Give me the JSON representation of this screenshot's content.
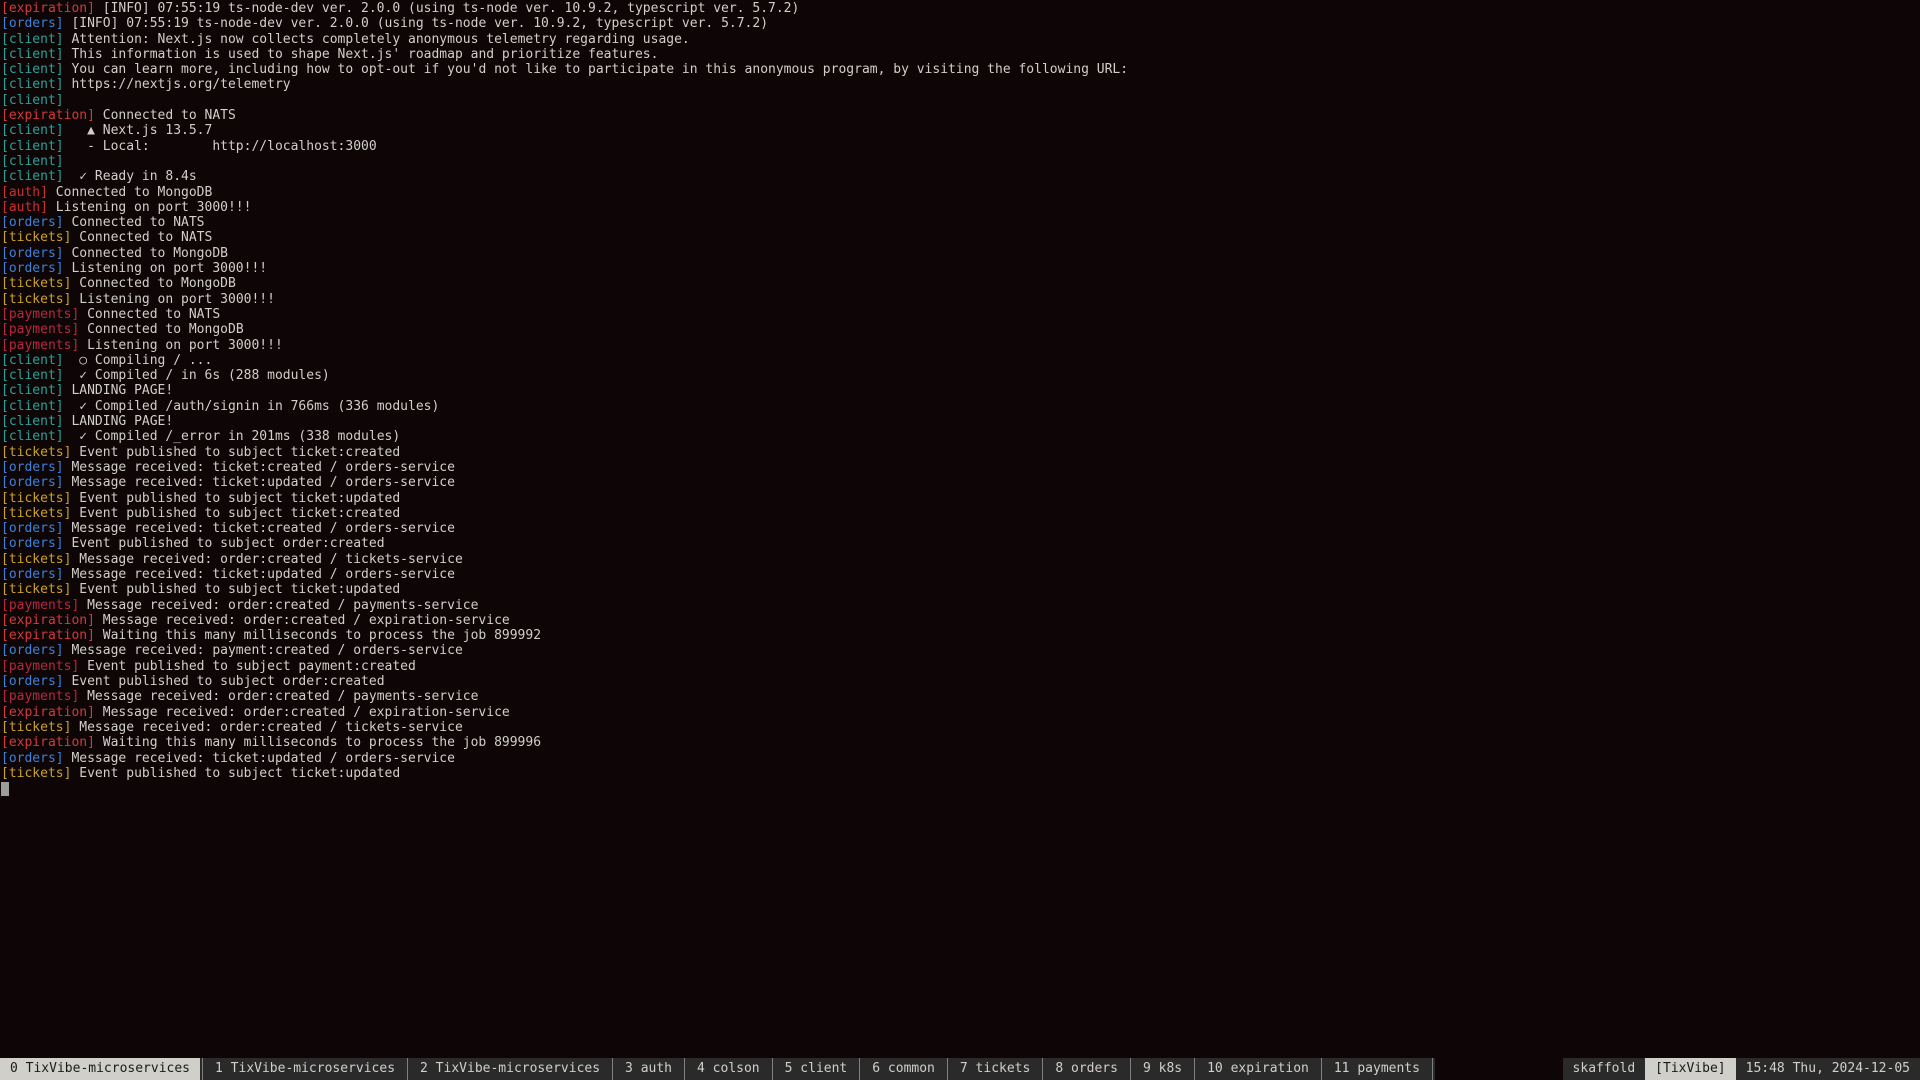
{
  "services": {
    "expiration": {
      "label": "[expiration]",
      "css": "c-expiration"
    },
    "orders": {
      "label": "[orders]",
      "css": "c-orders"
    },
    "client": {
      "label": "[client]",
      "css": "c-client"
    },
    "auth": {
      "label": "[auth]",
      "css": "c-auth"
    },
    "tickets": {
      "label": "[tickets]",
      "css": "c-tickets"
    },
    "payments": {
      "label": "[payments]",
      "css": "c-payments"
    }
  },
  "log_lines": [
    {
      "svc": "expiration",
      "msg": "[INFO] 07:55:19 ts-node-dev ver. 2.0.0 (using ts-node ver. 10.9.2, typescript ver. 5.7.2)"
    },
    {
      "svc": "orders",
      "msg": "[INFO] 07:55:19 ts-node-dev ver. 2.0.0 (using ts-node ver. 10.9.2, typescript ver. 5.7.2)"
    },
    {
      "svc": "client",
      "msg": "Attention: Next.js now collects completely anonymous telemetry regarding usage."
    },
    {
      "svc": "client",
      "msg": "This information is used to shape Next.js' roadmap and prioritize features."
    },
    {
      "svc": "client",
      "msg": "You can learn more, including how to opt-out if you'd not like to participate in this anonymous program, by visiting the following URL:"
    },
    {
      "svc": "client",
      "msg": "https://nextjs.org/telemetry"
    },
    {
      "svc": "client",
      "msg": ""
    },
    {
      "svc": "expiration",
      "msg": "Connected to NATS"
    },
    {
      "svc": "client",
      "msg": "  ▲ Next.js 13.5.7"
    },
    {
      "svc": "client",
      "msg": "  - Local:        http://localhost:3000"
    },
    {
      "svc": "client",
      "msg": ""
    },
    {
      "svc": "client",
      "msg": " ✓ Ready in 8.4s"
    },
    {
      "svc": "auth",
      "msg": "Connected to MongoDB"
    },
    {
      "svc": "auth",
      "msg": "Listening on port 3000!!!"
    },
    {
      "svc": "orders",
      "msg": "Connected to NATS"
    },
    {
      "svc": "tickets",
      "msg": "Connected to NATS"
    },
    {
      "svc": "orders",
      "msg": "Connected to MongoDB"
    },
    {
      "svc": "orders",
      "msg": "Listening on port 3000!!!"
    },
    {
      "svc": "tickets",
      "msg": "Connected to MongoDB"
    },
    {
      "svc": "tickets",
      "msg": "Listening on port 3000!!!"
    },
    {
      "svc": "payments",
      "msg": "Connected to NATS"
    },
    {
      "svc": "payments",
      "msg": "Connected to MongoDB"
    },
    {
      "svc": "payments",
      "msg": "Listening on port 3000!!!"
    },
    {
      "svc": "client",
      "msg": " ○ Compiling / ..."
    },
    {
      "svc": "client",
      "msg": " ✓ Compiled / in 6s (288 modules)"
    },
    {
      "svc": "client",
      "msg": "LANDING PAGE!"
    },
    {
      "svc": "client",
      "msg": " ✓ Compiled /auth/signin in 766ms (336 modules)"
    },
    {
      "svc": "client",
      "msg": "LANDING PAGE!"
    },
    {
      "svc": "client",
      "msg": " ✓ Compiled /_error in 201ms (338 modules)"
    },
    {
      "svc": "tickets",
      "msg": "Event published to subject ticket:created"
    },
    {
      "svc": "orders",
      "msg": "Message received: ticket:created / orders-service"
    },
    {
      "svc": "orders",
      "msg": "Message received: ticket:updated / orders-service"
    },
    {
      "svc": "tickets",
      "msg": "Event published to subject ticket:updated"
    },
    {
      "svc": "tickets",
      "msg": "Event published to subject ticket:created"
    },
    {
      "svc": "orders",
      "msg": "Message received: ticket:created / orders-service"
    },
    {
      "svc": "orders",
      "msg": "Event published to subject order:created"
    },
    {
      "svc": "tickets",
      "msg": "Message received: order:created / tickets-service"
    },
    {
      "svc": "orders",
      "msg": "Message received: ticket:updated / orders-service"
    },
    {
      "svc": "tickets",
      "msg": "Event published to subject ticket:updated"
    },
    {
      "svc": "payments",
      "msg": "Message received: order:created / payments-service"
    },
    {
      "svc": "expiration",
      "msg": "Message received: order:created / expiration-service"
    },
    {
      "svc": "expiration",
      "msg": "Waiting this many milliseconds to process the job 899992"
    },
    {
      "svc": "orders",
      "msg": "Message received: payment:created / orders-service"
    },
    {
      "svc": "payments",
      "msg": "Event published to subject payment:created"
    },
    {
      "svc": "orders",
      "msg": "Event published to subject order:created"
    },
    {
      "svc": "payments",
      "msg": "Message received: order:created / payments-service"
    },
    {
      "svc": "expiration",
      "msg": "Message received: order:created / expiration-service"
    },
    {
      "svc": "tickets",
      "msg": "Message received: order:created / tickets-service"
    },
    {
      "svc": "expiration",
      "msg": "Waiting this many milliseconds to process the job 899996"
    },
    {
      "svc": "orders",
      "msg": "Message received: ticket:updated / orders-service"
    },
    {
      "svc": "tickets",
      "msg": "Event published to subject ticket:updated"
    }
  ],
  "status": {
    "tabs": [
      {
        "label": "0 TixVibe-microservices",
        "active": true
      },
      {
        "label": "1 TixVibe-microservices",
        "active": false
      },
      {
        "label": "2 TixVibe-microservices",
        "active": false
      },
      {
        "label": "3 auth",
        "active": false
      },
      {
        "label": "4 colson",
        "active": false
      },
      {
        "label": "5 client",
        "active": false
      },
      {
        "label": "6 common",
        "active": false
      },
      {
        "label": "7 tickets",
        "active": false
      },
      {
        "label": "8 orders",
        "active": false
      },
      {
        "label": "9 k8s",
        "active": false
      },
      {
        "label": "10 expiration",
        "active": false
      },
      {
        "label": "11 payments",
        "active": false
      }
    ],
    "right": {
      "process": "skaffold",
      "session": "[TixVibe]",
      "clock": "15:48 Thu, 2024-12-05"
    }
  }
}
